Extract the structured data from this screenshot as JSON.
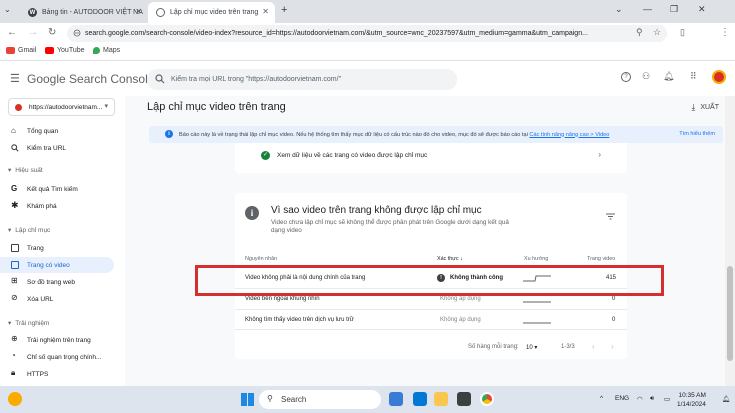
{
  "browser": {
    "tabs": [
      {
        "title": "Bảng tin - AUTODOOR VIỆT NA",
        "favicon": "wordpress-icon"
      },
      {
        "title": "Lập chỉ mục video trên trang",
        "favicon": "search-console-icon"
      }
    ],
    "url": "search.google.com/search-console/video-index?resource_id=https://autodoorvietnam.com/&utm_source=wnc_20237597&utm_medium=gamma&utm_campaign..."
  },
  "bookmarks": [
    "Gmail",
    "YouTube",
    "Maps"
  ],
  "gsc": {
    "logo": "Google Search Console",
    "search_placeholder": "Kiểm tra mọi URL trong \"https://autodoorvietnam.com/\""
  },
  "sidebar": {
    "property": "https://autodoorvietnam...",
    "items_top": [
      {
        "label": "Tổng quan",
        "icon": "home-icon"
      },
      {
        "label": "Kiểm tra URL",
        "icon": "search-icon"
      }
    ],
    "section_performance": "Hiệu suất",
    "items_perf": [
      {
        "label": "Kết quả Tìm kiếm",
        "icon": "google-g-icon"
      },
      {
        "label": "Khám phá",
        "icon": "asterisk-icon"
      }
    ],
    "section_index": "Lập chỉ mục",
    "items_index": [
      {
        "label": "Trang",
        "icon": "pages-icon"
      },
      {
        "label": "Trang có video",
        "icon": "video-page-icon",
        "active": true
      },
      {
        "label": "Sơ đồ trang web",
        "icon": "sitemap-icon"
      },
      {
        "label": "Xóa URL",
        "icon": "remove-url-icon"
      }
    ],
    "section_experience": "Trải nghiệm",
    "items_exp": [
      {
        "label": "Trải nghiệm trên trang",
        "icon": "page-experience-icon"
      },
      {
        "label": "Chỉ số quan trọng chính...",
        "icon": "gauge-icon"
      },
      {
        "label": "HTTPS",
        "icon": "lock-icon"
      }
    ]
  },
  "main": {
    "title": "Lập chỉ mục video trên trang",
    "export": "XUẤT",
    "info_text": "Báo cáo này là về trạng thái lập chỉ mục video. Nếu hệ thống tìm thấy mục dữ liệu có cấu trúc nào đó cho video, mục đó sẽ được báo cáo tại",
    "info_link": "Các tính năng nâng cao > Video",
    "info_more": "Tìm hiểu thêm",
    "card1_text": "Xem dữ liệu về các trang có video được lập chỉ mục",
    "card_title": "Vì sao video trên trang không được lập chỉ mục",
    "card_sub": "Video chưa lập chỉ mục sẽ không thể được phân phát trên Google dưới dạng kết quả dạng video",
    "columns": {
      "reason": "Nguyên nhân",
      "validation": "Xác thực",
      "trend": "Xu hướng",
      "videos": "Trang video"
    },
    "rows": [
      {
        "reason": "Video không phải là nội dung chính của trang",
        "validation": "Không thành công",
        "videos": "415"
      },
      {
        "reason": "Video bên ngoài khung nhìn",
        "validation": "Không áp dụng",
        "videos": "0"
      },
      {
        "reason": "Không tìm thấy video trên dịch vụ lưu trữ",
        "validation": "Không áp dụng",
        "videos": "0"
      }
    ],
    "pager": {
      "rows_label": "Số hàng mỗi trang:",
      "rows_value": "10",
      "range": "1-3/3"
    }
  },
  "taskbar": {
    "search": "Search",
    "lang": "ENG",
    "time": "10:35 AM",
    "date": "1/14/2024"
  },
  "colors": {
    "accent": "#1a73e8",
    "highlight": "#d32f2f",
    "active_bg": "#e8f0fe"
  }
}
